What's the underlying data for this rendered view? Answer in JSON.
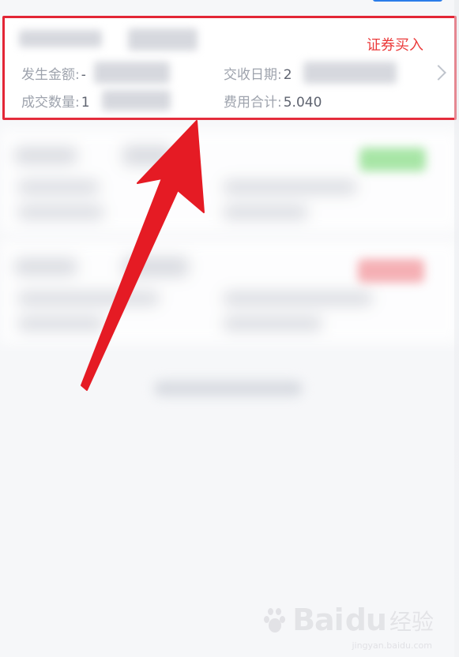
{
  "trade_record": {
    "type": "证券买入",
    "amount_label": "发生金额:",
    "amount_value_prefix": "-",
    "quantity_label": "成交数量:",
    "quantity_value_prefix": "1",
    "settlement_date_label": "交收日期:",
    "settlement_date_value_prefix": "2",
    "total_fees_label": "费用合计:",
    "total_fees_value": "5.040"
  },
  "watermark": {
    "brand": "Bai",
    "brand_suffix": "du",
    "product": "经验",
    "url": "jingyan.baidu.com"
  },
  "colors": {
    "highlight_border": "#e32636",
    "trade_type_text": "#eb3b3b",
    "arrow": "#e51b24",
    "page_bg": "#f6f7f9"
  },
  "icons": {
    "detail_chevron": "chevron-right-icon",
    "pointer_arrow": "red-arrow-icon",
    "watermark_logo": "baidu-paw-icon"
  }
}
